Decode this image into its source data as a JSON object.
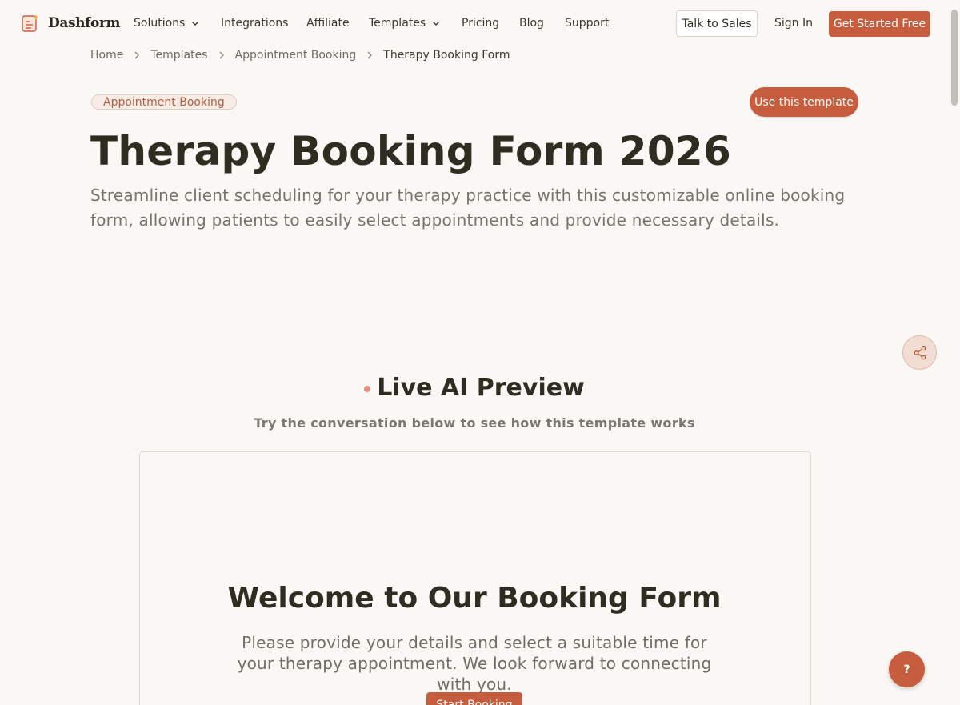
{
  "nav": {
    "logo_text": "Dashform",
    "links": {
      "solutions": "Solutions",
      "integrations": "Integrations",
      "affiliate": "Affiliate",
      "templates": "Templates",
      "pricing": "Pricing",
      "blog": "Blog",
      "support": "Support"
    },
    "talk_to_sales": "Talk to Sales",
    "sign_in": "Sign In",
    "get_started": "Get Started Free"
  },
  "breadcrumb": [
    "Home",
    "Templates",
    "Appointment Booking",
    "Therapy Booking Form"
  ],
  "hero": {
    "category": "Appointment Booking",
    "use_template": "Use this template",
    "title": "Therapy Booking Form 2026",
    "description": "Streamline client scheduling for your therapy practice with this customizable online booking form, allowing patients to easily select appointments and provide necessary details."
  },
  "preview": {
    "title": "Live AI Preview",
    "subtitle": "Try the conversation below to see how this template works",
    "form_title": "Welcome to Our Booking Form",
    "form_description": "Please provide your details and select a suitable time for your therapy appointment. We look forward to connecting with you.",
    "start_button": "Start Booking"
  },
  "floating": {
    "help": "?"
  },
  "colors": {
    "accent": "#c65d3f",
    "background": "#faf8f4",
    "text": "#2f2d22"
  }
}
